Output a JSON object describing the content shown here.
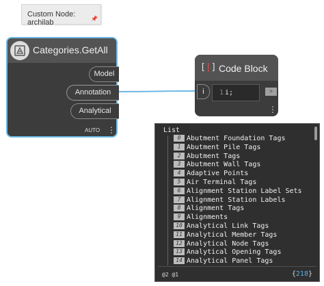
{
  "tooltip": {
    "text": "Custom Node: archilab",
    "pin_icon": "pin-icon"
  },
  "categories_node": {
    "title": "Categories.GetAll",
    "icon": "archilab-package-icon",
    "outputs": [
      "Model",
      "Annotation",
      "Analytical"
    ],
    "lacing": "AUTO",
    "menu_icon": "more-vertical-icon",
    "accent_color": "#6cb8e6"
  },
  "code_block": {
    "title": "Code Block",
    "input_label": "i",
    "line_number": "1",
    "code": "i;",
    "output_label": ">"
  },
  "preview": {
    "header": "List",
    "items": [
      {
        "index": "0",
        "label": "Abutment Foundation Tags"
      },
      {
        "index": "1",
        "label": "Abutment Pile Tags"
      },
      {
        "index": "2",
        "label": "Abutment Tags"
      },
      {
        "index": "3",
        "label": "Abutment Wall Tags"
      },
      {
        "index": "4",
        "label": "Adaptive Points"
      },
      {
        "index": "5",
        "label": "Air Terminal Tags"
      },
      {
        "index": "6",
        "label": "Alignment Station Label Sets"
      },
      {
        "index": "7",
        "label": "Alignment Station Labels"
      },
      {
        "index": "8",
        "label": "Alignment Tags"
      },
      {
        "index": "9",
        "label": "Alignments"
      },
      {
        "index": "10",
        "label": "Analytical Link Tags"
      },
      {
        "index": "11",
        "label": "Analytical Member Tags"
      },
      {
        "index": "12",
        "label": "Analytical Node Tags"
      },
      {
        "index": "13",
        "label": "Analytical Opening Tags"
      },
      {
        "index": "14",
        "label": "Analytical Panel Tags"
      }
    ],
    "levels": "@2 @1",
    "count": "218"
  }
}
